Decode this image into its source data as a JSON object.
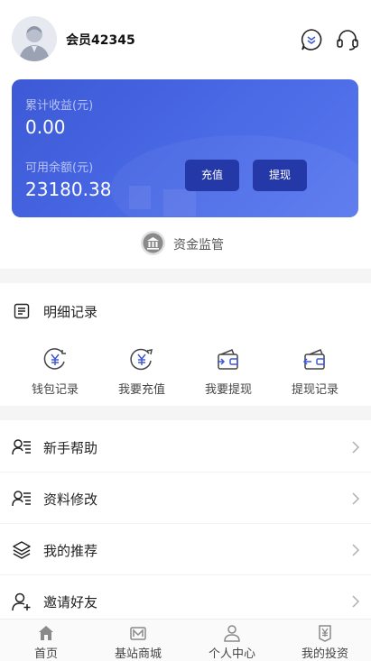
{
  "header": {
    "username": "会员42345",
    "icons": [
      "avatar",
      "message-icon",
      "customer-service-icon"
    ]
  },
  "card": {
    "total_income_label": "累计收益(元)",
    "total_income_value": "0.00",
    "balance_label": "可用余额(元)",
    "balance_value": "23180.38",
    "recharge_label": "充值",
    "withdraw_label": "提现",
    "colors": {
      "card_start": "#3d59d6",
      "card_end": "#5877ee",
      "button": "#2438a8"
    }
  },
  "fund_supervision": {
    "label": "资金监管",
    "icon": "bank-icon"
  },
  "details": {
    "title": "明细记录",
    "icon": "list-icon",
    "actions": [
      {
        "label": "钱包记录",
        "icon": "yen-coin-icon"
      },
      {
        "label": "我要充值",
        "icon": "yen-recharge-icon"
      },
      {
        "label": "我要提现",
        "icon": "wallet-out-icon"
      },
      {
        "label": "提现记录",
        "icon": "wallet-in-icon"
      }
    ]
  },
  "menu": [
    {
      "label": "新手帮助",
      "icon": "user-list-icon"
    },
    {
      "label": "资料修改",
      "icon": "user-edit-icon"
    },
    {
      "label": "我的推荐",
      "icon": "layers-icon"
    },
    {
      "label": "邀请好友",
      "icon": "user-add-icon"
    }
  ],
  "tabbar": [
    {
      "label": "首页",
      "icon": "home-icon"
    },
    {
      "label": "基站商城",
      "icon": "station-icon"
    },
    {
      "label": "个人中心",
      "icon": "person-icon"
    },
    {
      "label": "我的投资",
      "icon": "investment-icon"
    }
  ]
}
